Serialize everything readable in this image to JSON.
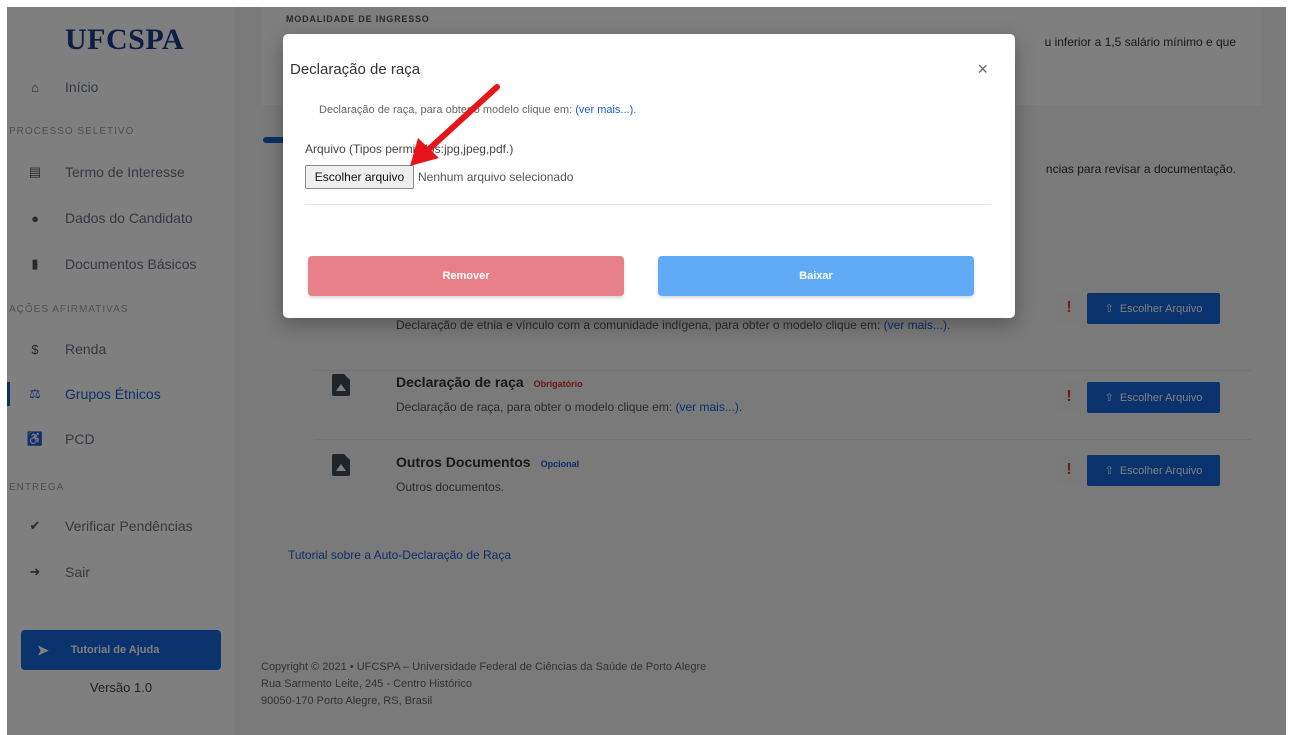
{
  "sidebar": {
    "logo": "UFCSPA",
    "home": "Início",
    "sections": {
      "processo": "PROCESSO SELETIVO",
      "acoes": "AÇÕES AFIRMATIVAS",
      "entrega": "ENTREGA"
    },
    "items": [
      {
        "label": "Termo de Interesse",
        "icon": "printer-icon"
      },
      {
        "label": "Dados do Candidato",
        "icon": "user-icon"
      },
      {
        "label": "Documentos Básicos",
        "icon": "file-icon"
      },
      {
        "label": "Renda",
        "icon": "dollar-icon"
      },
      {
        "label": "Grupos Étnicos",
        "icon": "balance-scale-icon"
      },
      {
        "label": "PCD",
        "icon": "wheelchair-icon"
      },
      {
        "label": "Verificar Pendências",
        "icon": "check-icon"
      },
      {
        "label": "Sair",
        "icon": "sign-out-icon"
      }
    ],
    "help_button": "Tutorial de Ajuda",
    "version": "Versão 1.0"
  },
  "main": {
    "modalidade_label": "MODALIDADE DE INGRESSO",
    "top_text": "u inferior a 1,5 salário mínimo e que",
    "mid_text": "ncias para revisar a documentação.",
    "documents": [
      {
        "title": "",
        "tag": "",
        "desc": "Declaração de etnia e vínculo com a comunidade indígena, para obter o modelo clique em:",
        "link": "(ver mais...)",
        "suffix": ".",
        "button": "Escolher Arquivo"
      },
      {
        "title": "Declaração de raça",
        "tag": "Obrigatório",
        "desc": "Declaração de raça, para obter o modelo clique em:",
        "link": "(ver mais...)",
        "suffix": ".",
        "button": "Escolher Arquivo"
      },
      {
        "title": "Outros Documentos",
        "tag": "Opcional",
        "desc": "Outros documentos.",
        "link": "",
        "suffix": "",
        "button": "Escolher Arquivo"
      }
    ],
    "tutorial_link": "Tutorial sobre a Auto-Declaração de Raça",
    "footer": {
      "line1": "Copyright © 2021  •  UFCSPA – Universidade Federal de Ciências da Saúde de Porto Alegre",
      "line2": "Rua Sarmento Leite, 245 - Centro Histórico",
      "line3": "90050-170 Porto Alegre, RS, Brasil"
    }
  },
  "modal": {
    "title": "Declaração de raça",
    "close": "×",
    "desc": "Declaração de raça, para obter o modelo clique em:",
    "desc_link": "(ver mais...)",
    "desc_suffix": ".",
    "file_label": "Arquivo (Tipos permitidos:jpg,jpeg,pdf.)",
    "file_button": "Escolher arquivo",
    "file_status": "Nenhum arquivo selecionado",
    "remove_button": "Remover",
    "download_button": "Baixar"
  },
  "colors": {
    "primary": "#1565d8",
    "required": "#d32f2f",
    "optional": "#1b5fd1",
    "remove": "#e8808a",
    "download": "#61aaf6",
    "arrow": "#e8141b"
  }
}
